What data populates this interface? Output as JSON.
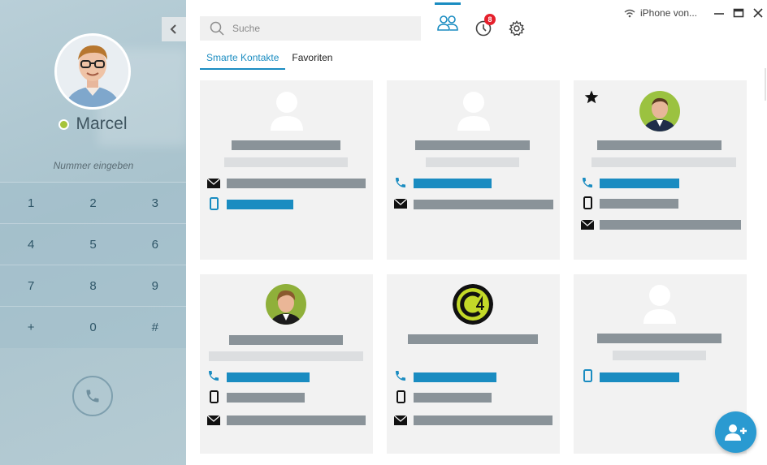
{
  "user": {
    "name": "Marcel",
    "status_color": "#a6c43a"
  },
  "dialer": {
    "placeholder": "Nummer eingeben",
    "keys": [
      [
        "1",
        "2",
        "3"
      ],
      [
        "4",
        "5",
        "6"
      ],
      [
        "7",
        "8",
        "9"
      ],
      [
        "+",
        "0",
        "#"
      ]
    ]
  },
  "search": {
    "placeholder": "Suche"
  },
  "toolbar": {
    "history_badge": "8"
  },
  "device": {
    "label": "iPhone von..."
  },
  "tabs": [
    {
      "label": "Smarte Kontakte",
      "active": true
    },
    {
      "label": "Favoriten",
      "active": false
    }
  ],
  "icons": {
    "collapse": "chevron-left-icon",
    "search": "search-icon",
    "contacts": "contacts-icon",
    "history": "history-icon",
    "settings": "gear-icon",
    "wifi": "wifi-icon",
    "minimize": "minimize-icon",
    "maximize": "maximize-icon",
    "close": "close-icon",
    "call": "phone-icon",
    "add_contact": "add-contact-icon"
  },
  "colors": {
    "accent": "#1a8cc1",
    "badge": "#e5202c",
    "card_bg": "#f2f2f2",
    "placeholder_bar": "#8a9399"
  }
}
